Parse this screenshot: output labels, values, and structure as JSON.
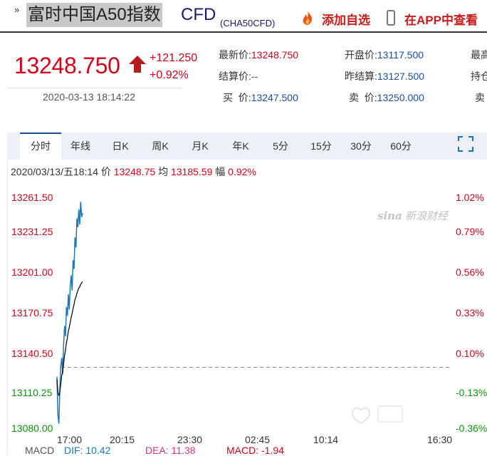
{
  "header": {
    "name": "富时中国A50指数",
    "cfd": "CFD",
    "code": "(CHA50CFD)",
    "add_favorite": "添加自选",
    "view_in_app": "在APP中查看"
  },
  "quote": {
    "price": "13248.750",
    "change": "+121.250",
    "change_pct": "+0.92%",
    "datetime": "2020-03-13 18:14:22",
    "fields": {
      "latest_label": "最新价:",
      "latest": "13248.750",
      "open_label": "开盘价:",
      "open": "13117.500",
      "high_label": "最高",
      "settle_label": "结算价:",
      "settle": "--",
      "prev_settle_label": "昨结算:",
      "prev_settle": "13127.500",
      "position_label": "持仓",
      "bid_label": "买  价:",
      "bid": "13247.500",
      "ask_label": "卖  价:",
      "ask": "13250.000",
      "sell_label": "卖"
    }
  },
  "chart_tabs": [
    "分时",
    "年线",
    "日K",
    "周K",
    "月K",
    "年K",
    "5分",
    "15分",
    "30分",
    "60分"
  ],
  "info_line": {
    "date": "2020/03/13/五18:14",
    "price_label": "价",
    "price": "13248.75",
    "avg_label": "均",
    "avg": "13185.59",
    "amp_label": "幅",
    "amp": "0.92%"
  },
  "watermark": "新浪财经",
  "macd": {
    "label": "MACD",
    "dif": "DIF: 10.42",
    "dea": "DEA: 11.38",
    "macd": "MACD: -1.94"
  },
  "colors": {
    "up": "#d0021b",
    "down": "#109010",
    "price_line": "#1f77b4",
    "avg_line": "#000000",
    "accent": "#1a4fa0"
  },
  "chart_data": {
    "type": "line",
    "title": "",
    "x_tick_labels": [
      "17:00",
      "20:15",
      "23:30",
      "02:45",
      "10:14",
      "16:30"
    ],
    "y_tick_labels": [
      "13261.50",
      "13231.25",
      "13201.00",
      "13170.75",
      "13140.50",
      "13110.25",
      "13080.00"
    ],
    "y_pct_labels": [
      "1.02%",
      "0.79%",
      "0.56%",
      "0.33%",
      "0.10%",
      "-0.13%",
      "-0.36%"
    ],
    "ylim": [
      13080.0,
      13261.5
    ],
    "reference_level": 13127.5,
    "series": [
      {
        "kind": "price",
        "values": [
          13120,
          13090,
          13083,
          13110,
          13128,
          13135,
          13122,
          13145,
          13160,
          13152,
          13175,
          13168,
          13185,
          13173,
          13192,
          13200,
          13188,
          13212,
          13205,
          13230,
          13222,
          13245,
          13238,
          13252,
          13240,
          13258,
          13246,
          13249
        ]
      },
      {
        "kind": "average",
        "values": [
          13118,
          13108,
          13105,
          13108,
          13114,
          13121,
          13124,
          13130,
          13137,
          13141,
          13147,
          13151,
          13156,
          13159,
          13163,
          13167,
          13170,
          13174,
          13177,
          13181,
          13183,
          13186,
          13188,
          13190,
          13191,
          13193,
          13194,
          13195
        ]
      }
    ]
  }
}
